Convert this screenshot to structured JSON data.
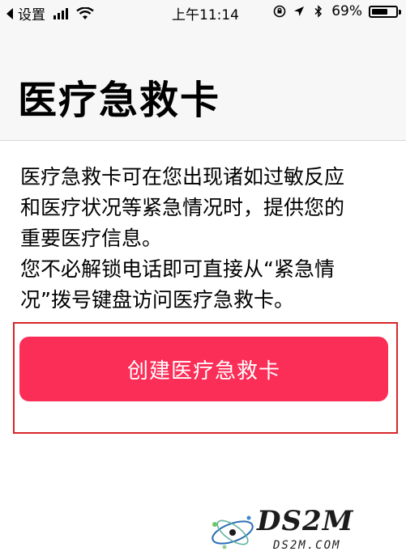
{
  "status_bar": {
    "back_app": "设置",
    "time": "上午11:14",
    "battery_percent": "69%",
    "battery_level": 0.69
  },
  "header": {
    "title": "医疗急救卡"
  },
  "description": {
    "paragraph1_line1": "医疗急救卡可在您出现诸如过敏反应",
    "paragraph1_line2": "和医疗状况等紧急情况时，提供您的",
    "paragraph1_line3": "重要医疗信息。",
    "paragraph2_line1": "您不必解锁电话即可直接从“紧急情",
    "paragraph2_line2": "况”拨号键盘访问医疗急救卡。"
  },
  "actions": {
    "create_label": "创建医疗急救卡"
  },
  "watermark": {
    "brand": "DS2M",
    "domain": "DS2M.COM"
  },
  "colors": {
    "button": "#fb2e58",
    "highlight_box": "#d7262a",
    "header_bg": "#f7f7f7"
  }
}
